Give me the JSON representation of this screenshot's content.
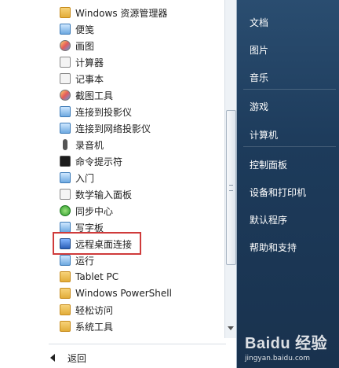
{
  "programs": {
    "items": [
      {
        "label": "Windows 资源管理器",
        "icon": "folder-icon"
      },
      {
        "label": "便笺",
        "icon": "sticky-notes-icon"
      },
      {
        "label": "画图",
        "icon": "paint-icon"
      },
      {
        "label": "计算器",
        "icon": "calculator-icon"
      },
      {
        "label": "记事本",
        "icon": "notepad-icon"
      },
      {
        "label": "截图工具",
        "icon": "snipping-tool-icon"
      },
      {
        "label": "连接到投影仪",
        "icon": "projector-icon"
      },
      {
        "label": "连接到网络投影仪",
        "icon": "network-projector-icon"
      },
      {
        "label": "录音机",
        "icon": "microphone-icon"
      },
      {
        "label": "命令提示符",
        "icon": "command-prompt-icon"
      },
      {
        "label": "入门",
        "icon": "getting-started-icon"
      },
      {
        "label": "数学输入面板",
        "icon": "math-input-icon"
      },
      {
        "label": "同步中心",
        "icon": "sync-center-icon"
      },
      {
        "label": "写字板",
        "icon": "wordpad-icon"
      },
      {
        "label": "远程桌面连接",
        "icon": "remote-desktop-icon"
      },
      {
        "label": "运行",
        "icon": "run-icon"
      },
      {
        "label": "Tablet PC",
        "icon": "folder-icon"
      },
      {
        "label": "Windows PowerShell",
        "icon": "folder-icon"
      },
      {
        "label": "轻松访问",
        "icon": "folder-icon"
      },
      {
        "label": "系统工具",
        "icon": "folder-icon"
      }
    ]
  },
  "highlighted_item": "远程桌面连接",
  "back_label": "返回",
  "right_menu": {
    "items": [
      {
        "label": "文档"
      },
      {
        "label": "图片"
      },
      {
        "label": "音乐"
      },
      {
        "label": "游戏"
      },
      {
        "label": "计算机"
      },
      {
        "label": "控制面板"
      },
      {
        "label": "设备和打印机"
      },
      {
        "label": "默认程序"
      },
      {
        "label": "帮助和支持"
      }
    ]
  },
  "watermark": {
    "logo": "Baidu 经验",
    "url": "jingyan.baidu.com"
  },
  "colors": {
    "highlight_border": "#cf3b3b",
    "right_pane": "#1f3b58"
  }
}
